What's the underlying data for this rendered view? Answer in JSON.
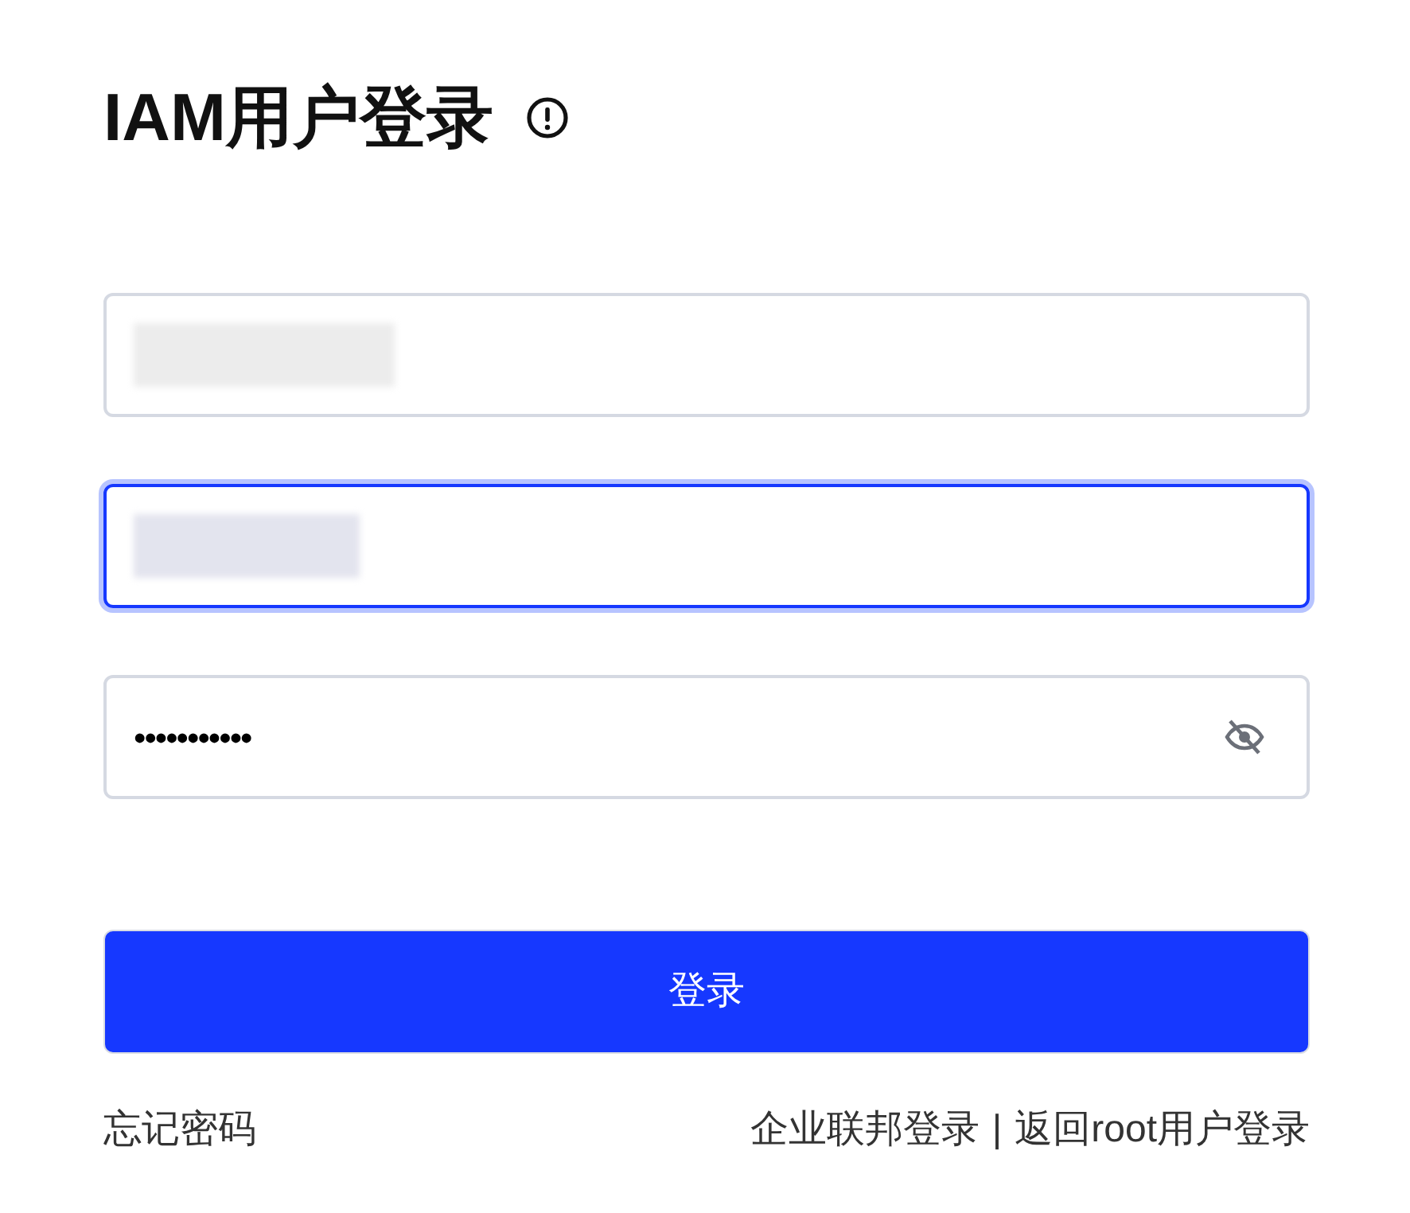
{
  "title": "IAM用户登录",
  "fields": [
    {
      "kind": "blurred",
      "focused": false
    },
    {
      "kind": "blurred",
      "focused": true
    },
    {
      "kind": "password",
      "value": "•••••••••••",
      "focused": false
    }
  ],
  "login_button": "登录",
  "forgot_link": "忘记密码",
  "links": [
    "企业联邦登录",
    "|",
    "返回root用户登录"
  ]
}
